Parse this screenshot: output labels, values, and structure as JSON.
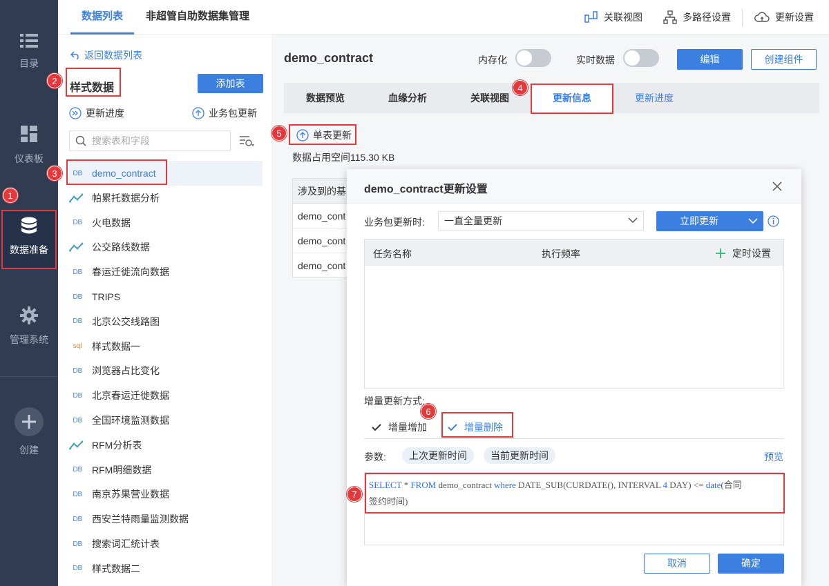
{
  "nav": {
    "items": [
      {
        "label": "目录",
        "icon": "list-icon"
      },
      {
        "label": "仪表板",
        "icon": "dashboard-icon"
      },
      {
        "label": "数据准备",
        "icon": "database-icon"
      },
      {
        "label": "管理系统",
        "icon": "gear-icon"
      },
      {
        "label": "创建",
        "icon": "plus-icon"
      }
    ]
  },
  "topbar": {
    "tabs": [
      "数据列表",
      "非超管自助数据集管理"
    ],
    "actions": [
      "关联视图",
      "多路径设置",
      "更新设置"
    ]
  },
  "left": {
    "back_label": "返回数据列表",
    "group_title": "样式数据",
    "add_table": "添加表",
    "update_progress": "更新进度",
    "package_update": "业务包更新",
    "search_placeholder": "搜索表和字段",
    "tables": [
      {
        "type": "DB",
        "name": "demo_contract"
      },
      {
        "type": "analysis",
        "name": "帕累托数据分析"
      },
      {
        "type": "DB",
        "name": "火电数据"
      },
      {
        "type": "analysis",
        "name": "公交路线数据"
      },
      {
        "type": "DB",
        "name": "春运迁徙流向数据"
      },
      {
        "type": "DB",
        "name": "TRIPS"
      },
      {
        "type": "DB",
        "name": "北京公交线路图"
      },
      {
        "type": "sql",
        "name": "样式数据一"
      },
      {
        "type": "DB",
        "name": "浏览器占比变化"
      },
      {
        "type": "DB",
        "name": "北京春运迁徙数据"
      },
      {
        "type": "DB",
        "name": "全国环境监测数据"
      },
      {
        "type": "analysis",
        "name": "RFM分析表"
      },
      {
        "type": "DB",
        "name": "RFM明细数据"
      },
      {
        "type": "DB",
        "name": "南京苏果营业数据"
      },
      {
        "type": "DB",
        "name": "西安兰特雨量监测数据"
      },
      {
        "type": "DB",
        "name": "搜索词汇统计表"
      },
      {
        "type": "DB",
        "name": "样式数据二"
      }
    ]
  },
  "main": {
    "title": "demo_contract",
    "memory_label": "内存化",
    "realtime_label": "实时数据",
    "edit_btn": "编辑",
    "create_btn": "创建组件",
    "tabs": [
      "数据预览",
      "血缘分析",
      "关联视图",
      "更新信息",
      "更新进度"
    ],
    "single_update": "单表更新",
    "space_text": "数据占用空间115.30 KB",
    "bg_table_header": "涉及到的基",
    "bg_rows": [
      "demo_cont",
      "demo_cont",
      "demo_cont"
    ]
  },
  "modal": {
    "title": "demo_contract更新设置",
    "pkg_update_label": "业务包更新时:",
    "pkg_update_value": "一直全量更新",
    "update_now": "立即更新",
    "col_task": "任务名称",
    "col_freq": "执行频率",
    "schedule": "定时设置",
    "incr_mode_label": "增量更新方式:",
    "incr_add": "增量增加",
    "incr_del": "增量删除",
    "params_label": "参数:",
    "param_last": "上次更新时间",
    "param_current": "当前更新时间",
    "preview": "预览",
    "sql": {
      "kw1": "SELECT",
      "t1": " * ",
      "kw2": "FROM",
      "t2": " demo_contract ",
      "kw3": "where",
      "t3": " DATE_SUB(CURDATE(), INTERVAL ",
      "num": "4",
      "t4": " DAY) <= ",
      "kw4": "date",
      "t5": "(合同",
      "line2": "签约时间)"
    },
    "cancel": "取消",
    "confirm": "确定"
  },
  "badges": [
    "1",
    "2",
    "3",
    "4",
    "5",
    "6",
    "7"
  ],
  "colors": {
    "accent": "#3b7fe0",
    "nav_bg": "#2f3c52",
    "highlight": "#e5383b"
  }
}
